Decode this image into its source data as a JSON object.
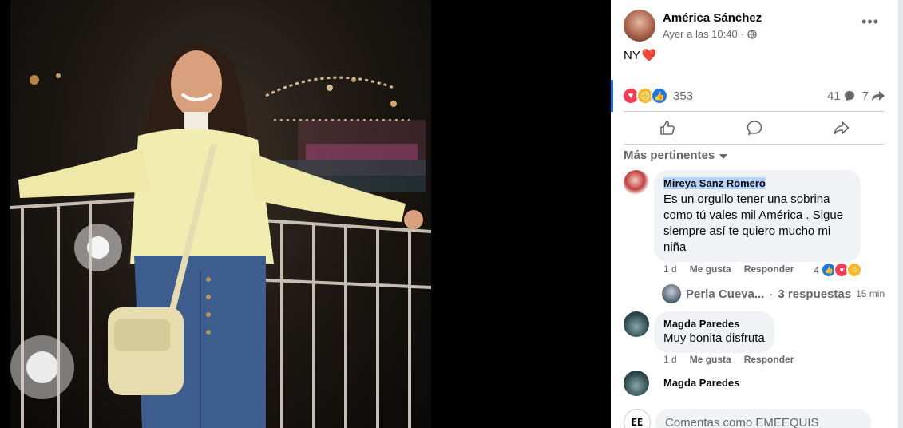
{
  "post": {
    "author": "América Sánchez",
    "timestamp": "Ayer a las 10:40",
    "separator": "·",
    "privacy_icon": "globe-icon",
    "text": "NY",
    "text_emoji": "❤️",
    "more_icon": "more-options-icon",
    "more_label": "•••"
  },
  "stats": {
    "reactions": [
      "love",
      "sad",
      "like"
    ],
    "reaction_count": "353",
    "comments_count": "41",
    "shares_count": "7"
  },
  "actions": [
    {
      "name": "like-button",
      "icon": "thumbs-up-icon"
    },
    {
      "name": "comment-button",
      "icon": "comment-bubble-icon"
    },
    {
      "name": "share-button",
      "icon": "share-arrow-icon"
    }
  ],
  "sort_label": "Más pertinentes",
  "comments": [
    {
      "name": "Mireya Sanz Romero",
      "text": "Es un orgullo tener una sobrina como tú vales mil América . Sigue siempre así te quiero mucho mi niña",
      "time": "1 d",
      "like_label": "Me gusta",
      "reply_label": "Responder",
      "reaction_count": "4",
      "reactions": [
        "like",
        "love",
        "care"
      ]
    },
    {
      "name": "Magda Paredes",
      "text": "Muy bonita disfruta",
      "time": "1 d",
      "like_label": "Me gusta",
      "reply_label": "Responder"
    },
    {
      "name": "Magda Paredes"
    }
  ],
  "replies": {
    "name": "Perla Cueva...",
    "separator": "·",
    "count_label": "3 respuestas",
    "time": "15 min"
  },
  "composer": {
    "placeholder": "Comentas como EMEEQUIS",
    "logo_text": "EE"
  },
  "colors": {
    "accent": "#1b74e4",
    "bubble": "#f0f2f5",
    "secondary_text": "#65676b"
  }
}
